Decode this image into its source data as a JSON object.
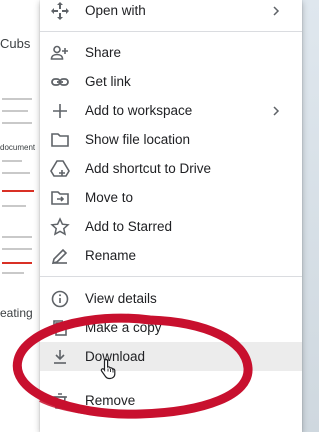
{
  "background": {
    "title_fragment": "Cubs",
    "doc_fragment": "document",
    "eating_fragment": "eating"
  },
  "menu": {
    "open_with": "Open with",
    "share": "Share",
    "get_link": "Get link",
    "add_to_workspace": "Add to workspace",
    "show_file_location": "Show file location",
    "add_shortcut": "Add shortcut to Drive",
    "move_to": "Move to",
    "add_to_starred": "Add to Starred",
    "rename": "Rename",
    "view_details": "View details",
    "make_a_copy": "Make a copy",
    "download": "Download",
    "remove": "Remove"
  },
  "annotation": {
    "circle_color": "#c8102e"
  }
}
